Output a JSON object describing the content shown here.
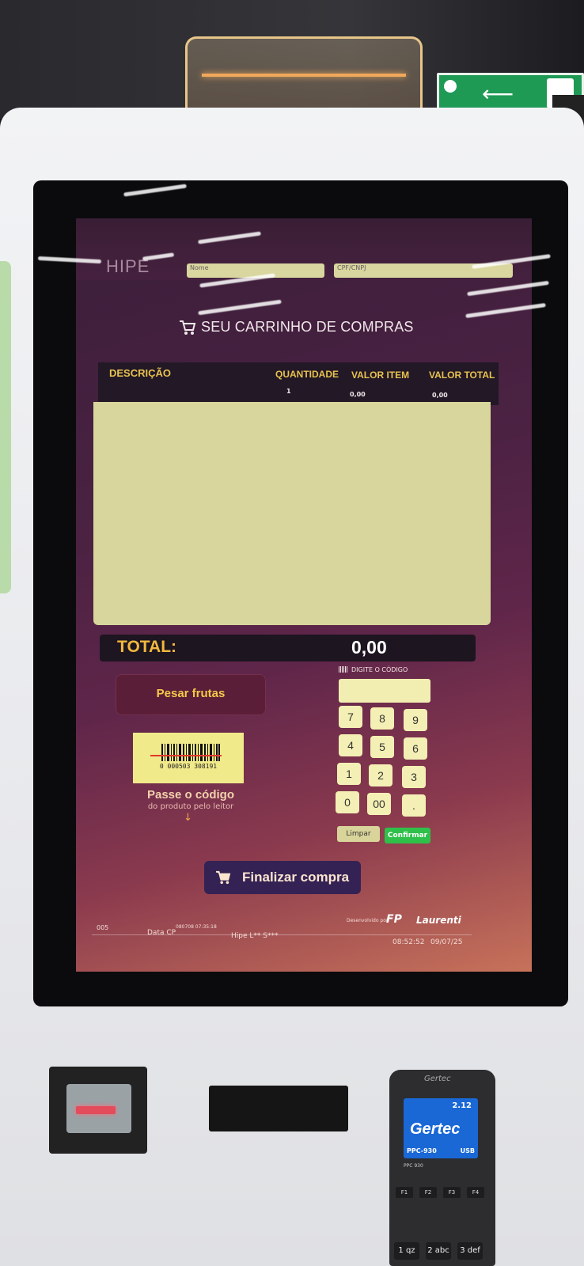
{
  "kiosk": {
    "logo": "HIPE",
    "fields": {
      "name_label": "Nome",
      "cpf_label": "CPF/CNPJ"
    },
    "cart_title": "SEU CARRINHO DE COMPRAS",
    "table": {
      "headers": [
        "DESCRIÇÃO",
        "QUANTIDADE",
        "VALOR ITEM",
        "VALOR TOTAL"
      ],
      "row": {
        "quantity": "1",
        "item_value": "0,00",
        "total_value": "0,00"
      }
    },
    "total": {
      "label": "TOTAL:",
      "value": "0,00"
    },
    "pesar_button": "Pesar frutas",
    "barcode": {
      "number": "0 000503 308191",
      "title": "Passe o código",
      "subtitle": "do produto pelo leitor",
      "arrow": "↓"
    },
    "keypad": {
      "code_label": "DIGITE O CÓDIGO",
      "keys": [
        "7",
        "8",
        "9",
        "4",
        "5",
        "6",
        "1",
        "2",
        "3",
        "0",
        "00",
        "."
      ],
      "clear": "Limpar",
      "confirm": "Confirmar"
    },
    "finalizar_button": "Finalizar compra",
    "footer": {
      "id": "005",
      "data_label": "Data CP",
      "data_value": "080708 07:35:18",
      "store": "Hipe L** S***",
      "developed_by": "Desenvolvido por",
      "brand_1": "FP",
      "brand_2": "Laurenti",
      "time": "08:52:52",
      "date": "09/07/25"
    },
    "colors": {
      "accent_yellow": "#e8c24f",
      "confirm_green": "#2fc04a",
      "screen_purple": "#4c2243"
    }
  },
  "pinpad": {
    "brand": "Gertec",
    "screen_number": "2.12",
    "screen_brand": "Gertec",
    "model": "PPC-930",
    "connection": "USB",
    "model_small": "PPC 930",
    "function_keys": [
      "F1",
      "F2",
      "F3",
      "F4"
    ],
    "number_keys": [
      "1 qz",
      "2 abc",
      "3 def"
    ]
  }
}
